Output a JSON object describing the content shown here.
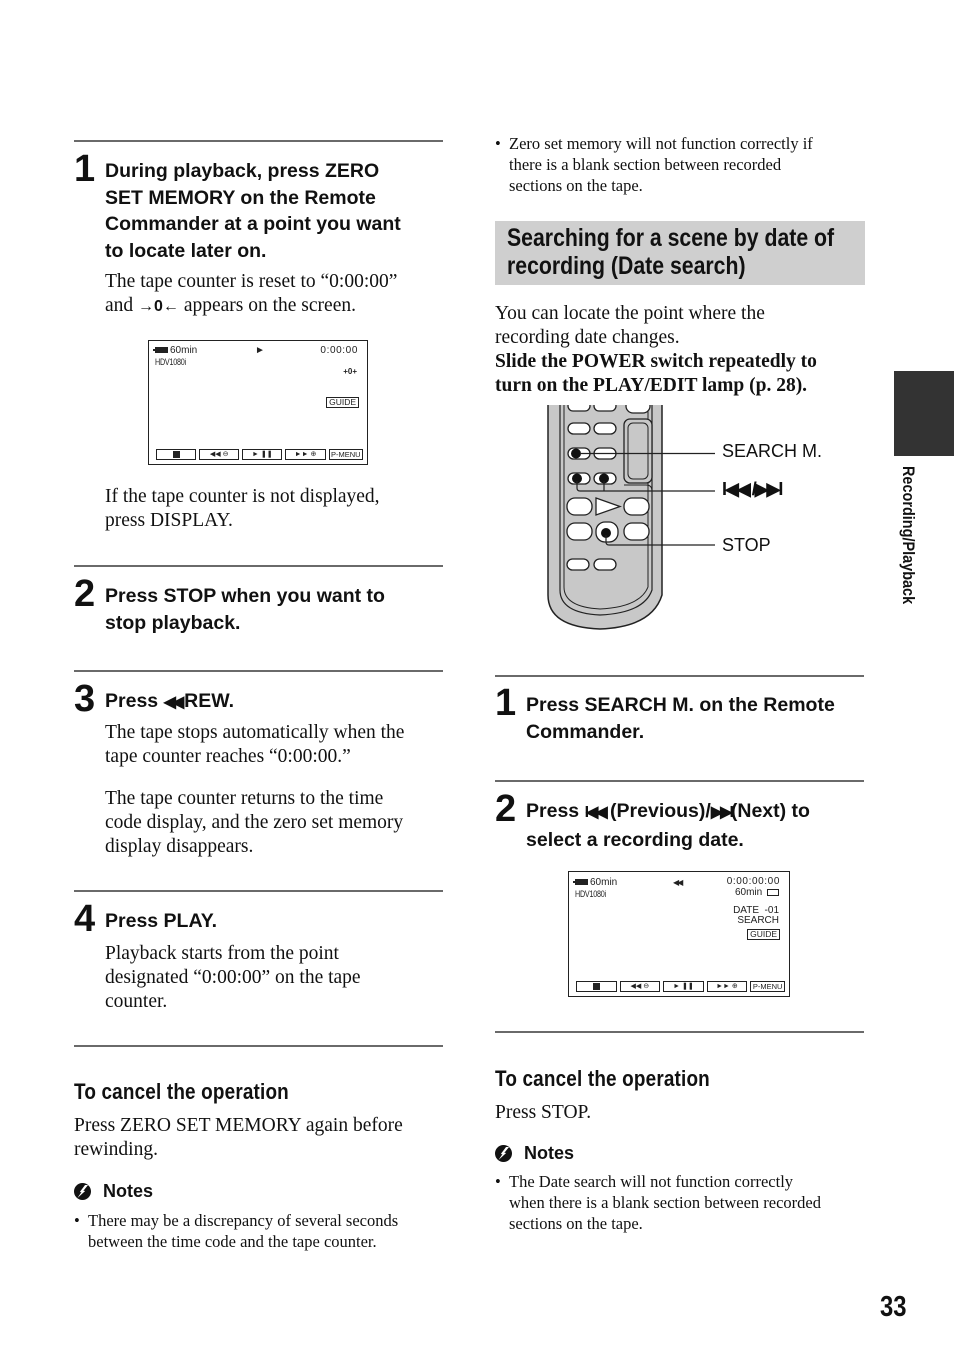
{
  "left_column": {
    "steps": [
      {
        "number": "1",
        "title": "During playback, press ZERO SET MEMORY on the Remote Commander at a point you want to locate later on.",
        "title_lines": [
          "During playback, press ZERO",
          "SET MEMORY on the Remote",
          "Commander at a point you want",
          "to locate later on."
        ],
        "body_line1": "The tape counter is reset to “0:00:00”",
        "body_line2_prefix": "and ",
        "body_line2_icon": "→0←",
        "body_line2_suffix": " appears on the screen.",
        "after_screen": "If the tape counter is not displayed, press DISPLAY.",
        "after_screen_lines": [
          "If the tape counter is not displayed,",
          "press DISPLAY."
        ]
      },
      {
        "number": "2",
        "title_lines": [
          "Press STOP when you want to",
          "stop playback."
        ]
      },
      {
        "number": "3",
        "title_prefix": "Press ",
        "title_icon": "◀◀",
        "title_suffix": "REW.",
        "body1_lines": [
          "The tape stops automatically when the",
          "tape counter reaches “0:00:00.”"
        ],
        "body2_lines": [
          "The tape counter returns to the time",
          "code display, and the zero set memory",
          "display disappears."
        ]
      },
      {
        "number": "4",
        "title_lines": [
          "Press PLAY."
        ],
        "body_lines": [
          "Playback starts from the point",
          "designated “0:00:00” on the tape",
          "counter."
        ]
      }
    ],
    "screen": {
      "battery": "60min",
      "format": "HDV1080i",
      "status_icon": "►",
      "counter": "0:00:00",
      "zero_set_icon": "+0+",
      "guide": "GUIDE",
      "controls": [
        "■",
        "◀◀ ⊖",
        "►  ❚❚",
        "►► ⊕",
        "P-MENU"
      ]
    },
    "cancel": {
      "heading": "To cancel the operation",
      "text_lines": [
        "Press ZERO SET MEMORY again before",
        "rewinding."
      ]
    },
    "notes": {
      "heading": "Notes",
      "items": [
        {
          "lines": [
            "There may be a discrepancy of several seconds",
            "between the time code and the tape counter."
          ]
        }
      ]
    }
  },
  "right_column": {
    "top_note": {
      "lines": [
        "Zero set memory will not function correctly if",
        "there is a blank section between recorded",
        "sections on the tape."
      ]
    },
    "section_title_lines": [
      "Searching for a scene by date of",
      "recording (Date search)"
    ],
    "intro_lines": [
      "You can locate the point where the",
      "recording date changes."
    ],
    "instruction_lines": [
      "Slide the POWER switch repeatedly to",
      "turn on the PLAY/EDIT lamp (p. 28)."
    ],
    "remote_callouts": {
      "search_m": "SEARCH M.",
      "prev_next": "I◀◀ /▶▶I",
      "stop": "STOP"
    },
    "steps": [
      {
        "number": "1",
        "title_lines": [
          "Press SEARCH M. on the Remote",
          "Commander."
        ]
      },
      {
        "number": "2",
        "title_line1_prefix": "Press ",
        "title_prev_icon": "I◀◀",
        "title_line1_mid": " (Previous)/",
        "title_next_icon": "▶▶I",
        "title_line1_suffix": "(Next) to",
        "title_line2": "select a recording date."
      }
    ],
    "screen": {
      "battery": "60min",
      "format": "HDV1080i",
      "status_icon": "◀◀",
      "counter": "0:00:00:00",
      "tape_remaining": "60min",
      "date_search_line1": "DATE  -01",
      "date_search_line2": "SEARCH",
      "guide": "GUIDE",
      "controls": [
        "■",
        "◀◀ ⊖",
        "►  ❚❚",
        "►► ⊕",
        "P-MENU"
      ]
    },
    "cancel": {
      "heading": "To cancel the operation",
      "text": "Press STOP."
    },
    "notes": {
      "heading": "Notes",
      "items": [
        {
          "lines": [
            "The Date search will not function correctly",
            "when there is a blank section between recorded",
            "sections on the tape."
          ]
        }
      ]
    }
  },
  "side_tab": {
    "label": "Recording/Playback",
    "color": "#333333"
  },
  "page_number": "33",
  "colors": {
    "rule": "#6a6a6a",
    "banner": "#cfcfcf"
  }
}
